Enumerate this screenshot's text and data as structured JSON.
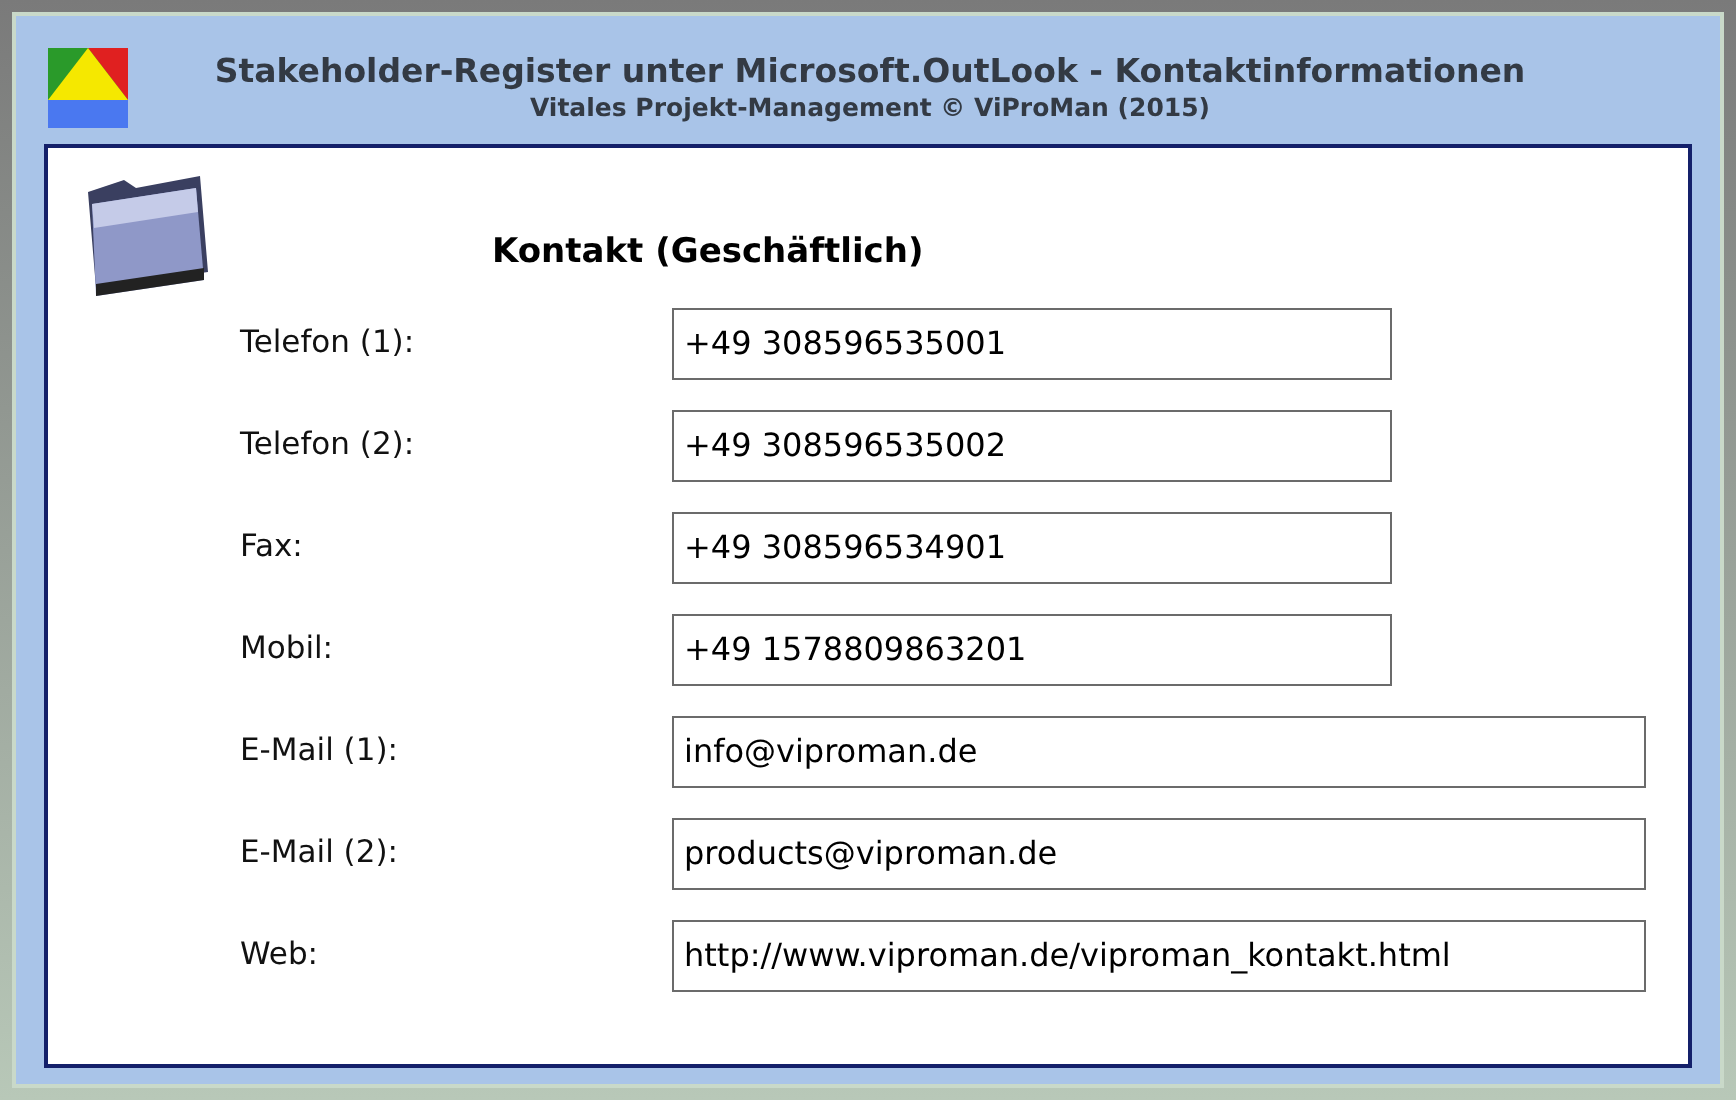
{
  "header": {
    "title": "Stakeholder-Register unter Microsoft.OutLook - Kontaktinformationen",
    "subtitle": "Vitales Projekt-Management © ViProMan  (2015)"
  },
  "section": {
    "title": "Kontakt (Geschäftlich)"
  },
  "fields": [
    {
      "label": "Telefon (1):",
      "value": "+49 308596535001",
      "kind": "short"
    },
    {
      "label": "Telefon (2):",
      "value": "+49 308596535002",
      "kind": "short"
    },
    {
      "label": "Fax:",
      "value": "+49 308596534901",
      "kind": "short"
    },
    {
      "label": "Mobil:",
      "value": "+49 1578809863201",
      "kind": "short"
    },
    {
      "label": "E-Mail (1):",
      "value": "info@viproman.de",
      "kind": "long"
    },
    {
      "label": "E-Mail (2):",
      "value": "products@viproman.de",
      "kind": "long"
    },
    {
      "label": "Web:",
      "value": "http://www.viproman.de/viproman_kontakt.html",
      "kind": "long"
    }
  ]
}
